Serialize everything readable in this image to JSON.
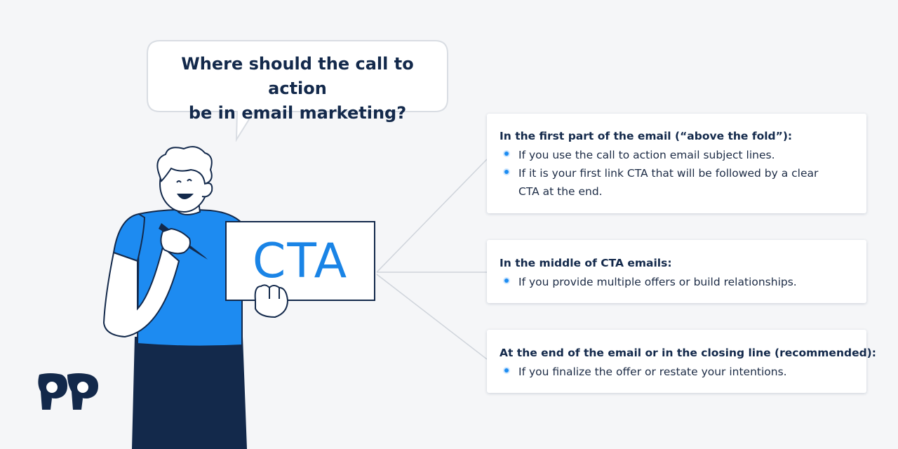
{
  "question": {
    "line1": "Where should the call to action",
    "line2": "be in email marketing?"
  },
  "sign": {
    "label": "CTA"
  },
  "cards": [
    {
      "title": "In the first part of the email (“above the fold”):",
      "items": [
        "If you use the call to action email subject lines.",
        "If it is your first link CTA that will be followed by a clear",
        "CTA at the end."
      ]
    },
    {
      "title": "In the middle of CTA emails:",
      "items": [
        "If you provide multiple offers or build relationships."
      ]
    },
    {
      "title": "At the end of the email or in the closing line (recommended):",
      "items": [
        "If you finalize the offer or restate your intentions."
      ]
    }
  ],
  "colors": {
    "navy": "#13294b",
    "accent_blue": "#1c8cf2",
    "shirt_blue": "#1d8bf1",
    "background": "#f5f6f8"
  },
  "icons": [
    "speech-bubble",
    "bullet-dot",
    "brand-logo"
  ]
}
